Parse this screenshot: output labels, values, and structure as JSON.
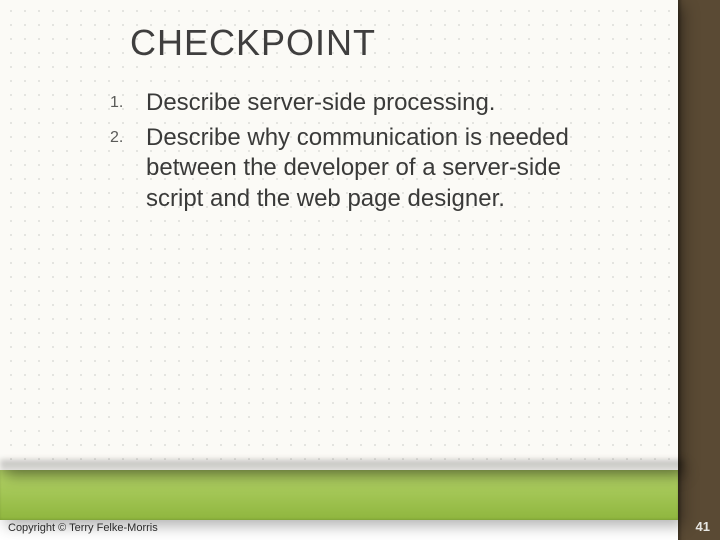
{
  "title": "CHECKPOINT",
  "items": [
    "Describe server-side processing.",
    "Describe why communication is needed between the developer of a server-side script and the web page designer."
  ],
  "copyright": "Copyright © Terry Felke-Morris",
  "page_number": "41"
}
